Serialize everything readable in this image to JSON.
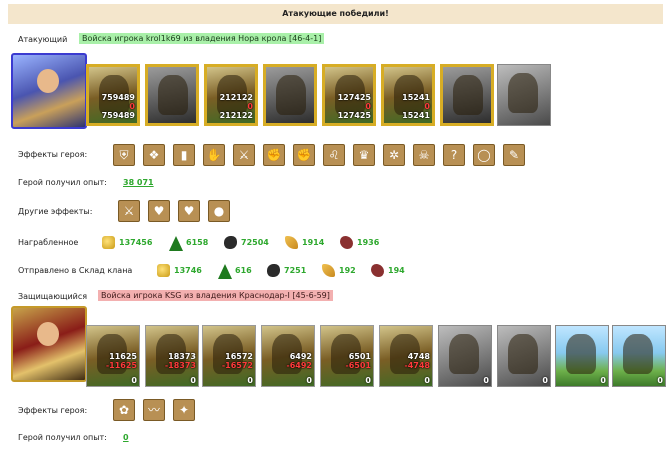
{
  "header": {
    "title": "Атакующие победили!"
  },
  "attacker": {
    "label": "Атакующий",
    "army": "Войска игрока krol1k69 из владения Нора крола [46-4-1]",
    "units": [
      {
        "top": "759489",
        "mid": "0",
        "bot": "759489",
        "style": "gold",
        "shown": true
      },
      {
        "top": "",
        "mid": "",
        "bot": "",
        "style": "gold-grey",
        "shown": false
      },
      {
        "top": "212122",
        "mid": "0",
        "bot": "212122",
        "style": "gold",
        "shown": true
      },
      {
        "top": "",
        "mid": "",
        "bot": "",
        "style": "gold-grey",
        "shown": false
      },
      {
        "top": "127425",
        "mid": "0",
        "bot": "127425",
        "style": "gold",
        "shown": true
      },
      {
        "top": "15241",
        "mid": "0",
        "bot": "15241",
        "style": "gold",
        "shown": true
      },
      {
        "top": "",
        "mid": "",
        "bot": "",
        "style": "gold-grey",
        "shown": false
      },
      {
        "top": "",
        "mid": "",
        "bot": "",
        "style": "grey",
        "shown": false
      }
    ],
    "effects_label": "Эффекты героя:",
    "effects": [
      "armor-icon",
      "book-icon",
      "shield-icon",
      "hands-icon",
      "sword-icon",
      "handshake-icon",
      "fist-icon",
      "lion-icon",
      "crown-icon",
      "web-icon",
      "demon-icon",
      "question-icon",
      "ring-icon",
      "scroll-icon"
    ],
    "exp_label": "Герой получил опыт:",
    "exp_value": "38 071",
    "other_label": "Другие эффекты:",
    "other_effects": [
      "sword-heart-icon",
      "heart-icon",
      "heart-shield-icon",
      "coins-icon"
    ],
    "loot_label": "Награбленное",
    "loot": [
      {
        "icon": "gold-icon",
        "value": "137456"
      },
      {
        "icon": "wood-icon",
        "value": "6158"
      },
      {
        "icon": "ore-icon",
        "value": "72504"
      },
      {
        "icon": "wheat-icon",
        "value": "1914"
      },
      {
        "icon": "gem-icon",
        "value": "1936"
      }
    ],
    "clan_label": "Отправлено в Склад клана",
    "clan": [
      {
        "icon": "gold-icon",
        "value": "13746"
      },
      {
        "icon": "wood-icon",
        "value": "616"
      },
      {
        "icon": "ore-icon",
        "value": "7251"
      },
      {
        "icon": "wheat-icon",
        "value": "192"
      },
      {
        "icon": "gem-icon",
        "value": "194"
      }
    ]
  },
  "defender": {
    "label": "Защищающийся",
    "army": "Войска игрока KSG из владения Краснодар-I [45-6-59]",
    "units": [
      {
        "top": "11625",
        "mid": "-11625",
        "zero": "0"
      },
      {
        "top": "18373",
        "mid": "-18373",
        "zero": "0"
      },
      {
        "top": "16572",
        "mid": "-16572",
        "zero": "0"
      },
      {
        "top": "6492",
        "mid": "-6492",
        "zero": "0"
      },
      {
        "top": "6501",
        "mid": "-6501",
        "zero": "0"
      },
      {
        "top": "4748",
        "mid": "-4748",
        "zero": "0"
      },
      {
        "top": "",
        "mid": "",
        "zero": "0"
      },
      {
        "top": "",
        "mid": "",
        "zero": "0"
      },
      {
        "top": "",
        "mid": "",
        "zero": "0"
      },
      {
        "top": "",
        "mid": "",
        "zero": "0"
      }
    ],
    "effects_label": "Эффекты героя:",
    "effects": [
      "gear-icon",
      "whip-icon",
      "feather-icon"
    ],
    "exp_label": "Герой получил опыт:",
    "exp_value": "0"
  },
  "colors": {
    "success_green": "#2ea82e",
    "attacker_tag": "#a9f0a9",
    "defender_tag": "#f3b0b0",
    "header_bg": "#f4e6cc"
  }
}
